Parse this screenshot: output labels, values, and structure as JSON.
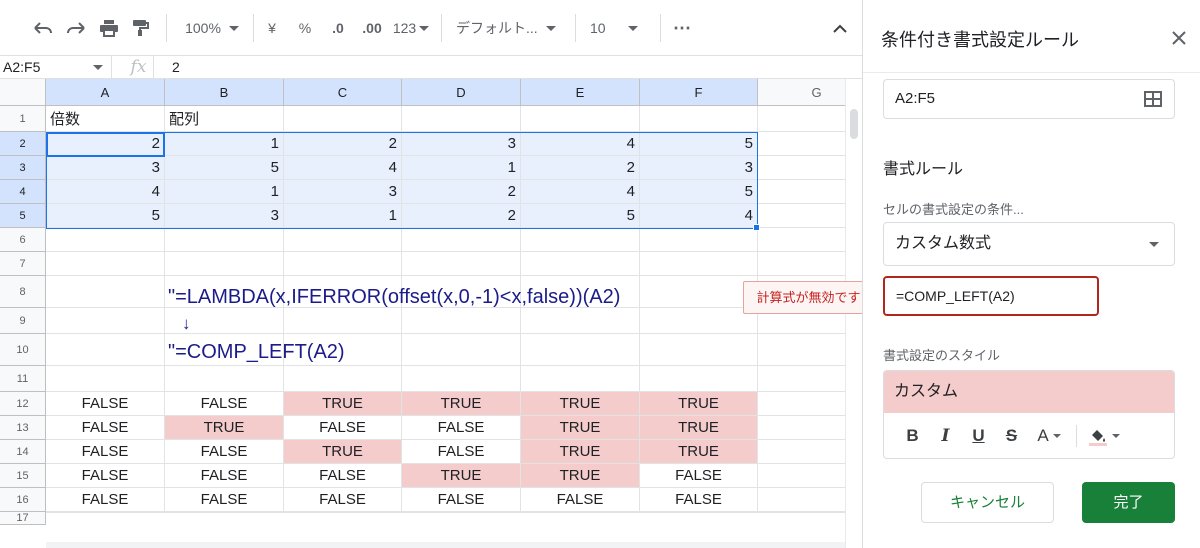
{
  "toolbar": {
    "zoom": "100%",
    "currency": "¥",
    "percent": "%",
    "dec_decrease": ".0",
    "dec_increase": ".00",
    "number_format": "123",
    "font": "デフォルト...",
    "font_size": "10",
    "more": "⋯",
    "collapse": "⌃"
  },
  "formula_bar": {
    "range": "A2:F5",
    "fx": "fx",
    "value": "2"
  },
  "sheet": {
    "columns": [
      "A",
      "B",
      "C",
      "D",
      "E",
      "F",
      "G"
    ],
    "rows": [
      "1",
      "2",
      "3",
      "4",
      "5",
      "6",
      "7",
      "8",
      "9",
      "10",
      "11",
      "12",
      "13",
      "14",
      "15",
      "16",
      "17"
    ],
    "header_row": {
      "a": "倍数",
      "b": "配列"
    },
    "data_rows": [
      [
        "2",
        "1",
        "2",
        "3",
        "4",
        "5"
      ],
      [
        "3",
        "5",
        "4",
        "1",
        "2",
        "3"
      ],
      [
        "4",
        "1",
        "3",
        "2",
        "4",
        "5"
      ],
      [
        "5",
        "3",
        "1",
        "2",
        "5",
        "4"
      ]
    ],
    "note_line1": "\"=LAMBDA(x,IFERROR(offset(x,0,-1)<x,false))(A2)",
    "note_arrow": "↓",
    "note_line2": "\"=COMP_LEFT(A2)",
    "bool_rows": [
      [
        "FALSE",
        "FALSE",
        "TRUE",
        "TRUE",
        "TRUE",
        "TRUE"
      ],
      [
        "FALSE",
        "TRUE",
        "FALSE",
        "FALSE",
        "TRUE",
        "TRUE"
      ],
      [
        "FALSE",
        "FALSE",
        "TRUE",
        "FALSE",
        "TRUE",
        "TRUE"
      ],
      [
        "FALSE",
        "FALSE",
        "FALSE",
        "TRUE",
        "TRUE",
        "FALSE"
      ],
      [
        "FALSE",
        "FALSE",
        "FALSE",
        "FALSE",
        "FALSE",
        "FALSE"
      ]
    ],
    "highlight_color": "#f4cccc",
    "selection_color": "#1a73e8"
  },
  "error_tooltip": "計算式が無効です",
  "panel": {
    "title": "条件付き書式設定ルール",
    "range": "A2:F5",
    "format_rules_heading": "書式ルール",
    "condition_label": "セルの書式設定の条件...",
    "condition_value": "カスタム数式",
    "formula": "=COMP_LEFT(A2)",
    "style_label": "書式設定のスタイル",
    "style_preview": "カスタム",
    "style_tools": {
      "bold": "B",
      "italic": "I",
      "underline": "U",
      "strike": "S",
      "text_color": "A"
    },
    "cancel": "キャンセル",
    "done": "完了",
    "accent_color": "#188038",
    "error_color": "#b3261e"
  }
}
